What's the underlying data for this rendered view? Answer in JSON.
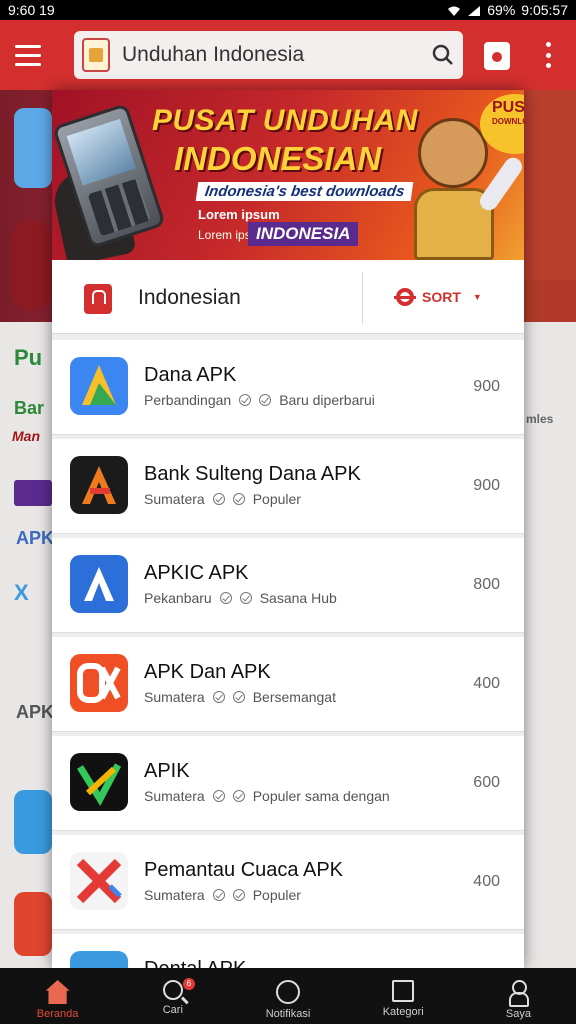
{
  "status_bar": {
    "time": "9:60 19",
    "battery": "69%",
    "clock": "9:05:57"
  },
  "app_bar": {
    "search_text": "Unduhan Indonesia",
    "icons": {
      "menu": "hamburger-icon",
      "search": "search-icon",
      "bag": "shopping-bag-icon",
      "more": "more-vert-icon"
    }
  },
  "promo": {
    "title_line1": "PUSAT UNDUHAN",
    "title_line2": "INDONESIAN",
    "sub1": "Indonesia's best downloads",
    "sub2": "Lorem ipsum",
    "sub3": "Lorem ipsum",
    "tag": "INDONESIA",
    "badge": "PUSAT",
    "badge_small": "DOWNLOAD"
  },
  "filter_bar": {
    "label": "Indonesian",
    "sort_label": "SORT"
  },
  "apps": [
    {
      "name": "Dana APK",
      "meta1": "Perbandingan",
      "meta2": "Baru diperbarui",
      "count": "900"
    },
    {
      "name": "Bank Sulteng Dana APK",
      "meta1": "Sumatera",
      "meta2": "Populer",
      "count": "900"
    },
    {
      "name": "APKIC APK",
      "meta1": "Pekanbaru",
      "meta2": "Sasana Hub",
      "count": "800"
    },
    {
      "name": "APK Dan APK",
      "meta1": "Sumatera",
      "meta2": "Bersemangat",
      "count": "400"
    },
    {
      "name": "APIK",
      "meta1": "Sumatera",
      "meta2": "Populer sama dengan",
      "count": "600"
    },
    {
      "name": "Pemantau Cuaca APK",
      "meta1": "Sumatera",
      "meta2": "Populer",
      "count": "400"
    },
    {
      "name": "Dental APK",
      "meta1": "",
      "meta2": "",
      "count": ""
    }
  ],
  "bottom_nav": [
    {
      "label": "Beranda",
      "icon": "home-icon"
    },
    {
      "label": "Cari",
      "icon": "search-icon",
      "badge": "6"
    },
    {
      "label": "Notifikasi",
      "icon": "circle-icon"
    },
    {
      "label": "Kategori",
      "icon": "square-icon"
    },
    {
      "label": "Saya",
      "icon": "person-icon"
    }
  ],
  "colors": {
    "brand": "#d32f2f",
    "accent": "#e24b3a"
  }
}
